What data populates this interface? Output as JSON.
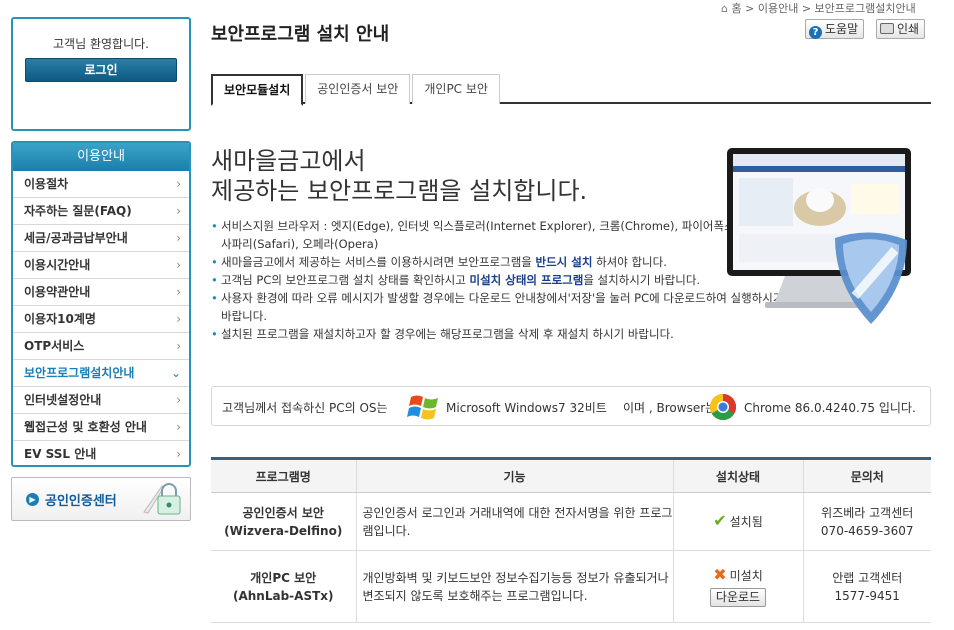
{
  "sidebar": {
    "welcome": "고객님 환영합니다.",
    "login_label": "로그인",
    "menu_title": "이용안내",
    "menu_items": [
      {
        "label": "이용절차"
      },
      {
        "label": "자주하는 질문(FAQ)"
      },
      {
        "label": "세금/공과금납부안내"
      },
      {
        "label": "이용시간안내"
      },
      {
        "label": "이용약관안내"
      },
      {
        "label": "이용자10계명"
      },
      {
        "label": "OTP서비스"
      },
      {
        "label": "보안프로그램설치안내",
        "active": true
      },
      {
        "label": "인터넷설정안내"
      },
      {
        "label": "웹접근성 및 호환성 안내"
      },
      {
        "label": "EV SSL 안내"
      }
    ],
    "cert_center_label": "공인인증센터"
  },
  "header": {
    "breadcrumb": [
      "홈",
      "이용안내",
      "보안프로그램설치안내"
    ],
    "title": "보안프로그램 설치 안내",
    "help_label": "도움말",
    "print_label": "인쇄"
  },
  "tabs": [
    {
      "label": "보안모듈설치",
      "active": true
    },
    {
      "label": "공인인증서 보안"
    },
    {
      "label": "개인PC 보안"
    }
  ],
  "intro": {
    "headline_line1": "새마을금고에서",
    "headline_line2": "제공하는 보안프로그램을 설치합니다.",
    "bullet1": "서비스지원 브라우저 : 엣지(Edge), 인터넷 익스플로러(Internet Explorer), 크롬(Chrome), 파이어폭스(Firefox), 사파리(Safari), 오페라(Opera)",
    "bullet2_pre": "새마을금고에서 제공하는 서비스를 이용하시려면 보안프로그램을 ",
    "bullet2_strong": "반드시 설치",
    "bullet2_post": " 하셔야 합니다.",
    "bullet3_pre": "고객님 PC의 보안프로그램 설치 상태를 확인하시고 ",
    "bullet3_strong": "미설치 상태의 프로그램",
    "bullet3_post": "을 설치하시기 바랍니다.",
    "bullet4": "사용자 환경에 따라 오류 메시지가 발생할 경우에는 다운로드 안내창에서'저장'을 눌러 PC에 다운로드하여 실행하시기 바랍니다.",
    "bullet5": "설치된 프로그램을 재설치하고자 할 경우에는 해당프로그램을 삭제 후 재설치 하시기 바랍니다."
  },
  "os_info": {
    "prefix": "고객님께서 접속하신 PC의 OS는",
    "os": "Microsoft Windows7 32비트",
    "middle": "이며 , Browser는",
    "browser": "Chrome 86.0.4240.75 입니다."
  },
  "table": {
    "headers": [
      "프로그램명",
      "기능",
      "설치상태",
      "문의처"
    ],
    "rows": [
      {
        "name1": "공인인증서 보안",
        "name2": "(Wizvera-Delfino)",
        "func": "공인인증서 로그인과 거래내역에 대한 전자서명을 위한 프로그램입니다.",
        "status": "설치됨",
        "contact1": "위즈베라 고객센터",
        "contact2": "070-4659-3607"
      },
      {
        "name1": "개인PC 보안",
        "name2": "(AhnLab-ASTx)",
        "func": "개인방화벽 및 키보드보안 정보수집기능등 정보가 유출되거나 변조되지 않도록 보호해주는 프로그램입니다.",
        "status": "미설치",
        "download_label": "다운로드",
        "contact1": "안랩 고객센터",
        "contact2": "1577-9451"
      }
    ]
  }
}
